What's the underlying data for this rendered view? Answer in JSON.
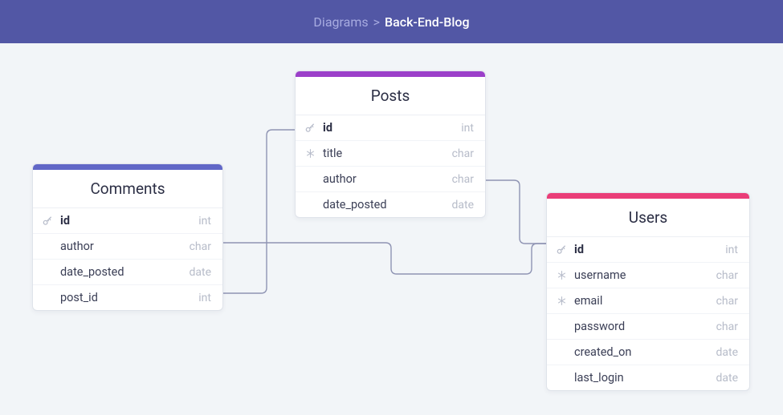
{
  "breadcrumb": {
    "root": "Diagrams",
    "sep": ">",
    "current": "Back-End-Blog"
  },
  "tables": {
    "comments": {
      "title": "Comments",
      "stripe": "#6167c7",
      "fields": [
        {
          "icon": "key",
          "name": "id",
          "type": "int",
          "pk": true
        },
        {
          "icon": "",
          "name": "author",
          "type": "char"
        },
        {
          "icon": "",
          "name": "date_posted",
          "type": "date"
        },
        {
          "icon": "",
          "name": "post_id",
          "type": "int"
        }
      ]
    },
    "posts": {
      "title": "Posts",
      "stripe": "#9b3fc9",
      "fields": [
        {
          "icon": "key",
          "name": "id",
          "type": "int",
          "pk": true
        },
        {
          "icon": "snow",
          "name": "title",
          "type": "char"
        },
        {
          "icon": "",
          "name": "author",
          "type": "char"
        },
        {
          "icon": "",
          "name": "date_posted",
          "type": "date"
        }
      ]
    },
    "users": {
      "title": "Users",
      "stripe": "#ea3d78",
      "fields": [
        {
          "icon": "key",
          "name": "id",
          "type": "int",
          "pk": true
        },
        {
          "icon": "snow",
          "name": "username",
          "type": "char"
        },
        {
          "icon": "snow",
          "name": "email",
          "type": "char"
        },
        {
          "icon": "",
          "name": "password",
          "type": "char"
        },
        {
          "icon": "",
          "name": "created_on",
          "type": "date"
        },
        {
          "icon": "",
          "name": "last_login",
          "type": "date"
        }
      ]
    }
  }
}
